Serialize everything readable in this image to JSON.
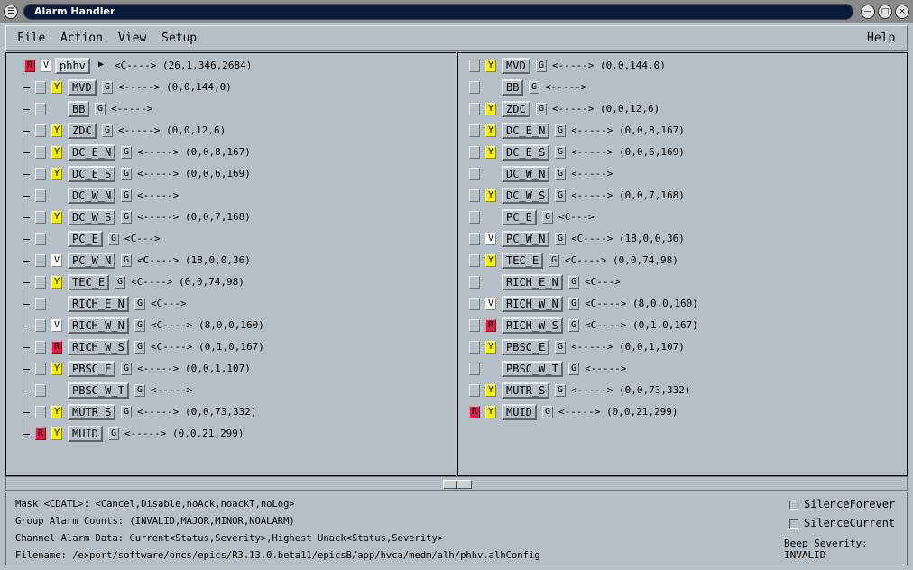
{
  "window": {
    "title": "Alarm Handler"
  },
  "menu": {
    "file": "File",
    "action": "Action",
    "view": "View",
    "setup": "Setup",
    "help": "Help"
  },
  "tree": {
    "root": {
      "ack": "R",
      "sev": "V",
      "name": "phhv",
      "desc": "<C----> (26,1,346,2684)"
    },
    "items": [
      {
        "sev": "Y",
        "name": "MVD",
        "g": "G",
        "desc": "<-----> (0,0,144,0)"
      },
      {
        "sev": "",
        "name": "BB",
        "g": "G",
        "desc": "<----->"
      },
      {
        "sev": "Y",
        "name": "ZDC",
        "g": "G",
        "desc": "<-----> (0,0,12,6)"
      },
      {
        "sev": "Y",
        "name": "DC_E_N",
        "g": "G",
        "desc": "<-----> (0,0,8,167)"
      },
      {
        "sev": "Y",
        "name": "DC_E_S",
        "g": "G",
        "desc": "<-----> (0,0,6,169)"
      },
      {
        "sev": "",
        "name": "DC_W_N",
        "g": "G",
        "desc": "<----->"
      },
      {
        "sev": "Y",
        "name": "DC_W_S",
        "g": "G",
        "desc": "<-----> (0,0,7,168)"
      },
      {
        "sev": "",
        "name": "PC_E",
        "g": "G",
        "desc": "<C--->"
      },
      {
        "sev": "V",
        "name": "PC_W_N",
        "g": "G",
        "desc": "<C----> (18,0,0,36)"
      },
      {
        "sev": "Y",
        "name": "TEC_E",
        "g": "G",
        "desc": "<C----> (0,0,74,98)"
      },
      {
        "sev": "",
        "name": "RICH_E_N",
        "g": "G",
        "desc": "<C--->"
      },
      {
        "sev": "V",
        "name": "RICH_W_N",
        "g": "G",
        "desc": "<C----> (8,0,0,160)"
      },
      {
        "sev": "R",
        "name": "RICH_W_S",
        "g": "G",
        "desc": "<C----> (0,1,0,167)"
      },
      {
        "sev": "Y",
        "name": "PBSC_E",
        "g": "G",
        "desc": "<-----> (0,0,1,107)"
      },
      {
        "sev": "",
        "name": "PBSC_W_T",
        "g": "G",
        "desc": "<----->"
      },
      {
        "sev": "Y",
        "name": "MUTR_S",
        "g": "G",
        "desc": "<-----> (0,0,73,332)"
      },
      {
        "ack": "R",
        "sev": "Y",
        "name": "MUID",
        "g": "G",
        "desc": "<-----> (0,0,21,299)"
      }
    ]
  },
  "list": {
    "items": [
      {
        "sev": "Y",
        "name": "MVD",
        "g": "G",
        "desc": "<-----> (0,0,144,0)"
      },
      {
        "sev": "",
        "name": "BB",
        "g": "G",
        "desc": "<----->"
      },
      {
        "sev": "Y",
        "name": "ZDC",
        "g": "G",
        "desc": "<-----> (0,0,12,6)"
      },
      {
        "sev": "Y",
        "name": "DC_E_N",
        "g": "G",
        "desc": "<-----> (0,0,8,167)"
      },
      {
        "sev": "Y",
        "name": "DC_E_S",
        "g": "G",
        "desc": "<-----> (0,0,6,169)"
      },
      {
        "sev": "",
        "name": "DC_W_N",
        "g": "G",
        "desc": "<----->"
      },
      {
        "sev": "Y",
        "name": "DC_W_S",
        "g": "G",
        "desc": "<-----> (0,0,7,168)"
      },
      {
        "sev": "",
        "name": "PC_E",
        "g": "G",
        "desc": "<C--->"
      },
      {
        "sev": "V",
        "name": "PC_W_N",
        "g": "G",
        "desc": "<C----> (18,0,0,36)"
      },
      {
        "sev": "Y",
        "name": "TEC_E",
        "g": "G",
        "desc": "<C----> (0,0,74,98)"
      },
      {
        "sev": "",
        "name": "RICH_E_N",
        "g": "G",
        "desc": "<C--->"
      },
      {
        "sev": "V",
        "name": "RICH_W_N",
        "g": "G",
        "desc": "<C----> (8,0,0,160)"
      },
      {
        "sev": "R",
        "name": "RICH_W_S",
        "g": "G",
        "desc": "<C----> (0,1,0,167)"
      },
      {
        "sev": "Y",
        "name": "PBSC_E",
        "g": "G",
        "desc": "<-----> (0,0,1,107)"
      },
      {
        "sev": "",
        "name": "PBSC_W_T",
        "g": "G",
        "desc": "<----->"
      },
      {
        "sev": "Y",
        "name": "MUTR_S",
        "g": "G",
        "desc": "<-----> (0,0,73,332)"
      },
      {
        "ack": "R",
        "sev": "Y",
        "name": "MUID",
        "g": "G",
        "desc": "<-----> (0,0,21,299)"
      }
    ]
  },
  "status": {
    "mask": "Mask <CDATL>: <Cancel,Disable,noAck,noackT,noLog>",
    "group_counts": "Group Alarm Counts: (INVALID,MAJOR,MINOR,NOALARM)",
    "channel_data": "Channel Alarm Data: Current<Status,Severity>,Highest Unack<Status,Severity>",
    "filename": "Filename: /export/software/oncs/epics/R3.13.0.beta11/epicsB/app/hvca/medm/alh/phhv.alhConfig",
    "silence_forever": "SilenceForever",
    "silence_current": "SilenceCurrent",
    "beep_severity": "Beep Severity: INVALID"
  },
  "colors": {
    "red": "#e0204a",
    "yellow": "#f8f000",
    "white": "#ffffff",
    "panel": "#b4bfc7"
  }
}
